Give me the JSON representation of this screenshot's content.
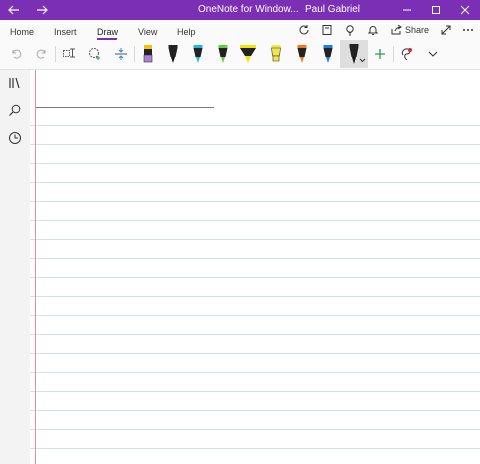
{
  "titlebar": {
    "app_title": "OneNote for Window...",
    "user_name": "Paul Gabriel",
    "back_icon": "back-arrow-icon",
    "forward_icon": "forward-arrow-icon",
    "minimize_icon": "minimize-icon",
    "maximize_icon": "maximize-icon",
    "close_icon": "close-icon",
    "color": "#7b2fb5"
  },
  "ribbon": {
    "tabs": [
      {
        "label": "Home"
      },
      {
        "label": "Insert"
      },
      {
        "label": "Draw",
        "active": true
      },
      {
        "label": "View"
      },
      {
        "label": "Help"
      }
    ],
    "share_label": "Share",
    "right_icons": [
      "sync-icon",
      "notebook-icon",
      "lightbulb-icon",
      "bell-icon",
      "share-icon",
      "expand-icon",
      "more-icon"
    ]
  },
  "draw_toolbar": {
    "tools": [
      "undo-icon",
      "redo-icon",
      "lasso-select-icon",
      "add-shape-icon",
      "add-space-icon"
    ],
    "pens": [
      {
        "name": "pen-purple",
        "color": "#b07fd8"
      },
      {
        "name": "pen-black",
        "color": "#111111"
      },
      {
        "name": "pen-cyan",
        "color": "#1fb9e0"
      },
      {
        "name": "pen-green",
        "color": "#5fce3a"
      },
      {
        "name": "highlighter-yellow",
        "color": "#f2e600"
      },
      {
        "name": "highlighter-yellow-2",
        "color": "#f0e84a"
      },
      {
        "name": "pen-orange",
        "color": "#f07a1a"
      },
      {
        "name": "pen-blue",
        "color": "#1f7fd8"
      },
      {
        "name": "pen-black-selected",
        "color": "#111111"
      }
    ],
    "add_pen_icon": "plus-icon",
    "ink_to_shape_icon": "ink-replay-icon",
    "more_icon": "chevron-down-icon"
  },
  "sidebar": {
    "icons": [
      "notebooks-icon",
      "search-icon",
      "recent-icon"
    ]
  },
  "page": {
    "rule_color": "#cde3ea",
    "margin_color": "#e89090"
  }
}
